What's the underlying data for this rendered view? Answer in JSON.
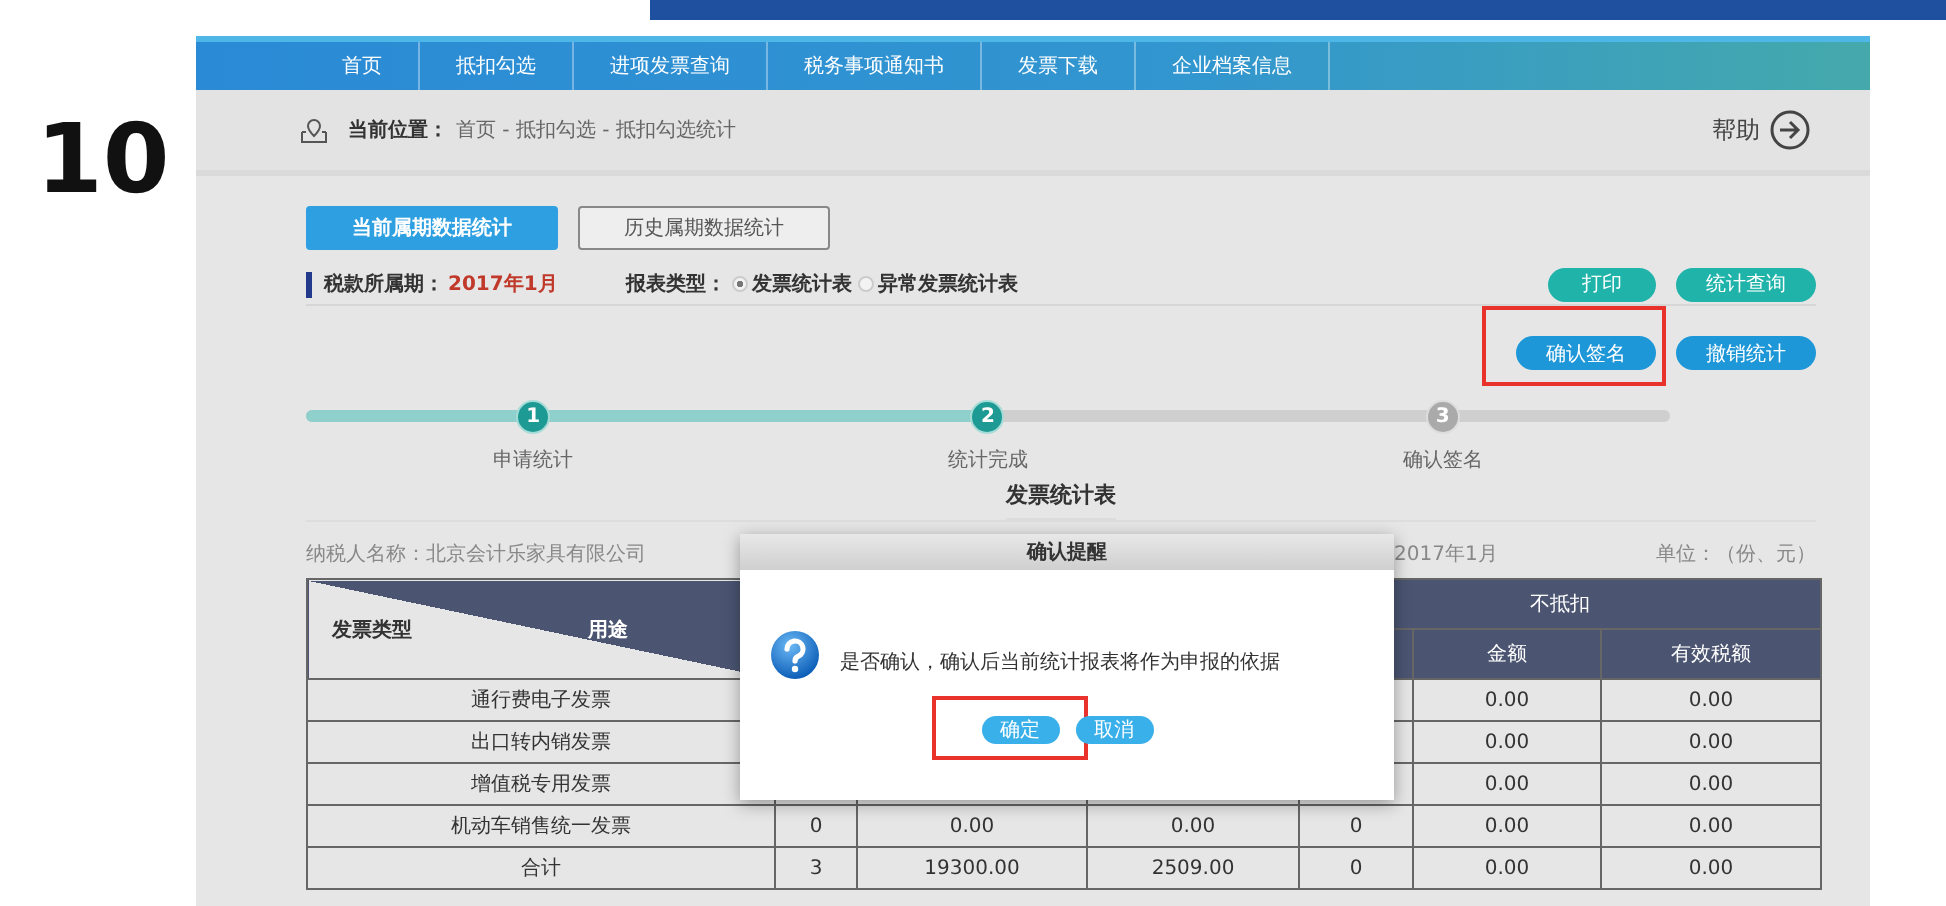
{
  "slide_number": "10",
  "nav": {
    "items": [
      "首页",
      "抵扣勾选",
      "进项发票查询",
      "税务事项通知书",
      "发票下载",
      "企业档案信息"
    ]
  },
  "breadcrumb": {
    "label": "当前位置：",
    "path": "首页 - 抵扣勾选 - 抵扣勾选统计",
    "help": "帮助"
  },
  "tabs": [
    {
      "label": "当前属期数据统计",
      "selected": true
    },
    {
      "label": "历史属期数据统计",
      "selected": false
    }
  ],
  "period": {
    "label": "税款所属期：",
    "value": "2017年1月"
  },
  "report_type": {
    "label": "报表类型：",
    "options": [
      {
        "label": "发票统计表",
        "selected": true
      },
      {
        "label": "异常发票统计表",
        "selected": false
      }
    ]
  },
  "buttons_row1": [
    {
      "label": "打印",
      "highlighted": false
    },
    {
      "label": "统计查询",
      "highlighted": false
    }
  ],
  "buttons_row2": [
    {
      "label": "确认签名",
      "highlighted": true
    },
    {
      "label": "撤销统计",
      "highlighted": false
    }
  ],
  "steps": [
    {
      "number": "1",
      "label": "申请统计",
      "done": true
    },
    {
      "number": "2",
      "label": "统计完成",
      "done": true
    },
    {
      "number": "3",
      "label": "确认签名",
      "done": false
    }
  ],
  "report": {
    "title": "发票统计表",
    "taxpayer": "纳税人名称：北京会计乐家具有限公司",
    "period": "2017年1月",
    "unit": "单位：（份、元）"
  },
  "table": {
    "corner_row_label": "发票类型",
    "corner_column_label": "用途",
    "group_header": "不抵扣",
    "subheaders": [
      "金额",
      "有效税额"
    ],
    "rows": [
      {
        "type": "通行费电子发票",
        "nd_amount": "0.00",
        "nd_tax": "0.00"
      },
      {
        "type": "出口转内销发票",
        "nd_amount": "0.00",
        "nd_tax": "0.00"
      },
      {
        "type": "增值税专用发票",
        "nd_amount": "0.00",
        "nd_tax": "0.00"
      },
      {
        "type": "机动车销售统一发票",
        "count": "0",
        "amount": "0.00",
        "tax": "0.00",
        "nd_count": "0",
        "nd_amount": "0.00",
        "nd_tax": "0.00"
      },
      {
        "type": "合计",
        "count": "3",
        "amount": "19300.00",
        "tax": "2509.00",
        "nd_count": "0",
        "nd_amount": "0.00",
        "nd_tax": "0.00"
      }
    ]
  },
  "dialog": {
    "title": "确认提醒",
    "message": "是否确认，确认后当前统计报表将作为申报的依据",
    "buttons": [
      {
        "label": "确定",
        "highlighted": true
      },
      {
        "label": "取消",
        "highlighted": false
      }
    ]
  }
}
